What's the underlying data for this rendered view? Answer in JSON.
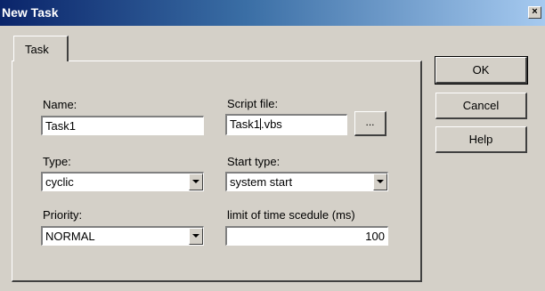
{
  "window": {
    "title": "New Task",
    "close_glyph": "×"
  },
  "tabs": [
    {
      "label": "Task"
    }
  ],
  "form": {
    "name": {
      "label": "Name:",
      "value": "Task1"
    },
    "script_file": {
      "label": "Script file:",
      "value_before_caret": "Task1",
      "value_after_caret": ".vbs",
      "browse_label": "..."
    },
    "type": {
      "label": "Type:",
      "value": "cyclic"
    },
    "start_type": {
      "label": "Start type:",
      "value": "system start"
    },
    "priority": {
      "label": "Priority:",
      "value": "NORMAL"
    },
    "time_limit": {
      "label": "limit of time scedule (ms)",
      "value": "100"
    }
  },
  "buttons": {
    "ok": "OK",
    "cancel": "Cancel",
    "help": "Help"
  },
  "icons": {
    "dropdown": "chevron-down-icon",
    "close": "close-icon"
  },
  "colors": {
    "dialog_bg": "#d4d0c8",
    "title_start": "#0a246a",
    "title_end": "#a6caf0"
  }
}
